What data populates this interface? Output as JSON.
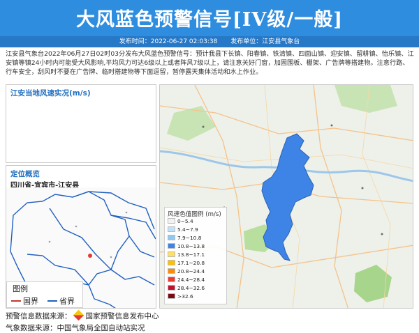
{
  "header": {
    "title": "大风蓝色预警信号[IV级/一般]",
    "publish_time_label": "发布时间：2022-06-27 02:03:38",
    "publisher_label": "发布单位：江安县气象台"
  },
  "description": "江安县气象台2022年06月27日02时03分发布大风蓝色预警信号：预计我县下长镇、阳春镇、铁清镇、四面山镇、迎安镇、留耕镇、怡乐镇、江安镇等镇24小时内可能受大风影响,平均风力可达6级以上或者阵风7级以上，请注意关好门窗，加固围板、棚架、广告牌等搭建物。注意行路、行车安全，刮风时不要在广告牌、临时搭建物等下面逗留，暂停露天集体活动和水上作业。",
  "wind_panel": {
    "title": "江安当地风速实况(m/s)"
  },
  "location_panel": {
    "title": "定位概览",
    "location": "四川省-宜宾市-江安县",
    "legend_title": "图例",
    "legend_items": [
      {
        "label": "国界",
        "color": "#c0392b"
      },
      {
        "label": "省界",
        "color": "#1f5fbf"
      }
    ]
  },
  "map": {
    "region_color": "#3e84e6",
    "legend_title": "风速色值图例 (m/s)",
    "legend": [
      {
        "label": "0~5.4",
        "color": "#f2f2f2"
      },
      {
        "label": "5.4~7.9",
        "color": "#bfe3fb"
      },
      {
        "label": "7.9~10.8",
        "color": "#8ccaf6"
      },
      {
        "label": "10.8~13.8",
        "color": "#3e84e6"
      },
      {
        "label": "13.8~17.1",
        "color": "#ffe066"
      },
      {
        "label": "17.1~20.8",
        "color": "#ffc000"
      },
      {
        "label": "20.8~24.4",
        "color": "#ff8c00"
      },
      {
        "label": "24.4~28.4",
        "color": "#f03a2e"
      },
      {
        "label": "28.4~32.6",
        "color": "#c0122a"
      },
      {
        "label": ">32.6",
        "color": "#7b0a12"
      }
    ]
  },
  "footer": {
    "source_prefix": "预警信息数据来源：",
    "source_name": "国家预警信息发布中心",
    "weather_source": "气象数据来源：中国气象局全国自动站实况"
  }
}
